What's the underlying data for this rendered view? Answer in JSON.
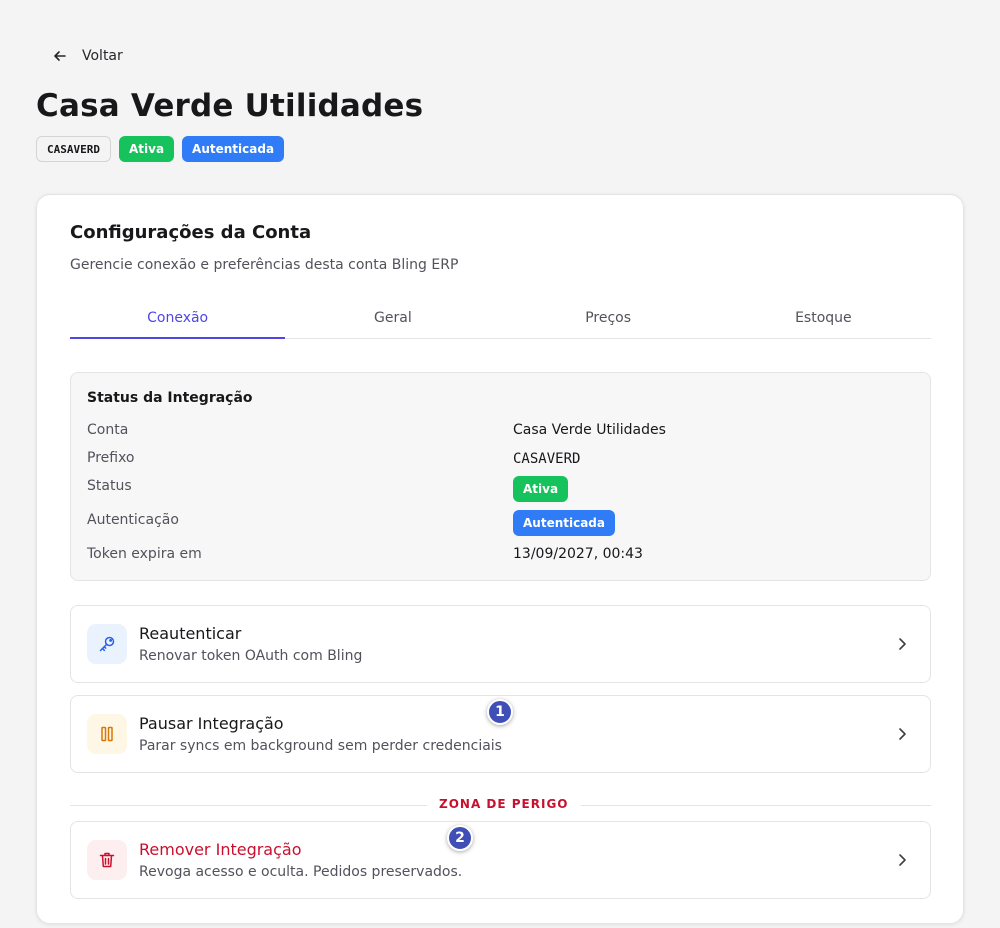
{
  "header": {
    "back_label": "Voltar",
    "title": "Casa Verde Utilidades",
    "badges": {
      "code": "CASAVERD",
      "status": "Ativa",
      "auth": "Autenticada"
    }
  },
  "card": {
    "title": "Configurações da Conta",
    "subtitle": "Gerencie conexão e preferências desta conta Bling ERP",
    "tabs": [
      {
        "label": "Conexão",
        "active": true
      },
      {
        "label": "Geral",
        "active": false
      },
      {
        "label": "Preços",
        "active": false
      },
      {
        "label": "Estoque",
        "active": false
      }
    ]
  },
  "status_panel": {
    "title": "Status da Integração",
    "rows": {
      "account": {
        "label": "Conta",
        "value": "Casa Verde Utilidades"
      },
      "prefix": {
        "label": "Prefixo",
        "value": "CASAVERD"
      },
      "status": {
        "label": "Status",
        "value": "Ativa"
      },
      "auth": {
        "label": "Autenticação",
        "value": "Autenticada"
      },
      "token": {
        "label": "Token expira em",
        "value": "13/09/2027, 00:43"
      }
    }
  },
  "actions": {
    "reauth": {
      "title": "Reautenticar",
      "description": "Renovar token OAuth com Bling",
      "icon": "key-icon"
    },
    "pause": {
      "title": "Pausar Integração",
      "description": "Parar syncs em background sem perder credenciais",
      "icon": "pause-icon"
    },
    "danger_zone_label": "ZONA DE PERIGO",
    "remove": {
      "title": "Remover Integração",
      "description": "Revoga acesso e oculta. Pedidos preservados.",
      "icon": "trash-icon"
    }
  },
  "markers": [
    "1",
    "2"
  ],
  "colors": {
    "accent": "#4f46e5",
    "success": "#16c25c",
    "info": "#2f7cf6",
    "danger": "#c8102e",
    "marker": "#3f4fb5"
  }
}
